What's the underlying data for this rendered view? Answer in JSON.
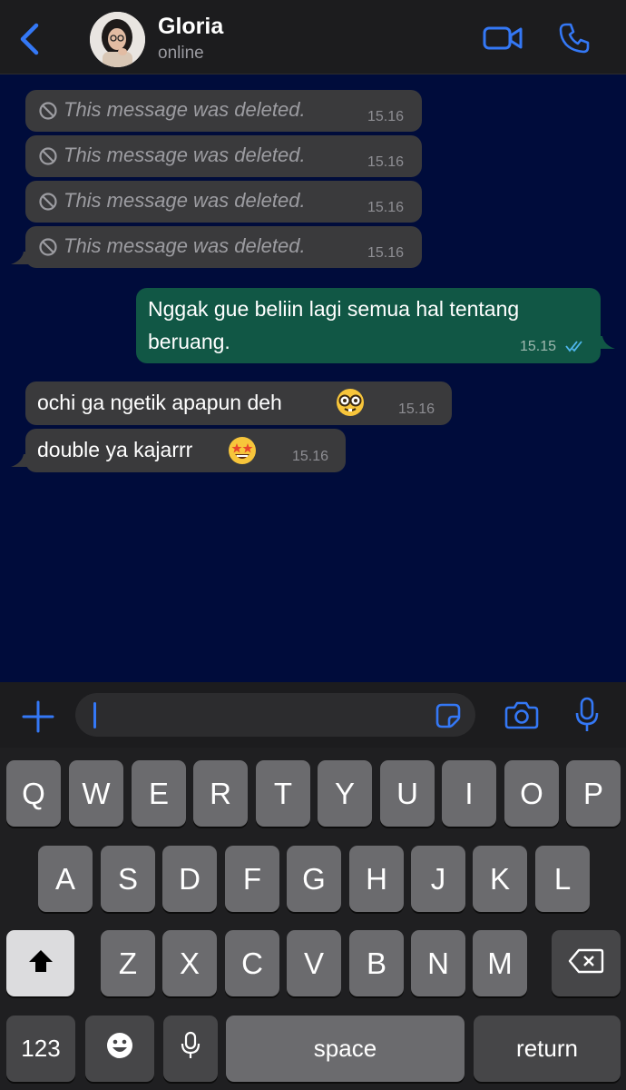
{
  "header": {
    "contact_name": "Gloria",
    "status": "online",
    "icons": [
      "back-chevron-icon",
      "video-call-icon",
      "phone-call-icon"
    ]
  },
  "messages": [
    {
      "direction": "incoming",
      "deleted": true,
      "text": "This message was deleted.",
      "time": "15.16"
    },
    {
      "direction": "incoming",
      "deleted": true,
      "text": "This message was deleted.",
      "time": "15.16"
    },
    {
      "direction": "incoming",
      "deleted": true,
      "text": "This message was deleted.",
      "time": "15.16"
    },
    {
      "direction": "incoming",
      "deleted": true,
      "text": "This message was deleted.",
      "time": "15.16"
    },
    {
      "direction": "outgoing",
      "line1": "Nggak gue beliin lagi semua hal tentang",
      "line2": "beruang.",
      "time": "15.15",
      "read": true
    },
    {
      "direction": "incoming",
      "text": "ochi ga ngetik apapun deh",
      "emoji": "nerd-face-emoji",
      "time": "15.16"
    },
    {
      "direction": "incoming",
      "text": "double ya kajarrr",
      "emoji": "star-struck-emoji",
      "time": "15.16"
    }
  ],
  "composer": {
    "input_value": "",
    "icons": [
      "plus-icon",
      "sticker-icon",
      "camera-icon",
      "microphone-icon"
    ]
  },
  "keyboard": {
    "row1": [
      "Q",
      "W",
      "E",
      "R",
      "T",
      "Y",
      "U",
      "I",
      "O",
      "P"
    ],
    "row2": [
      "A",
      "S",
      "D",
      "F",
      "G",
      "H",
      "J",
      "K",
      "L"
    ],
    "row3": [
      "Z",
      "X",
      "C",
      "V",
      "B",
      "N",
      "M"
    ],
    "numbers_label": "123",
    "space_label": "space",
    "return_label": "return"
  },
  "colors": {
    "chat_background": "#000c3b",
    "incoming_bubble": "#3a3a3c",
    "outgoing_bubble": "#115745",
    "accent": "#3478f6"
  }
}
